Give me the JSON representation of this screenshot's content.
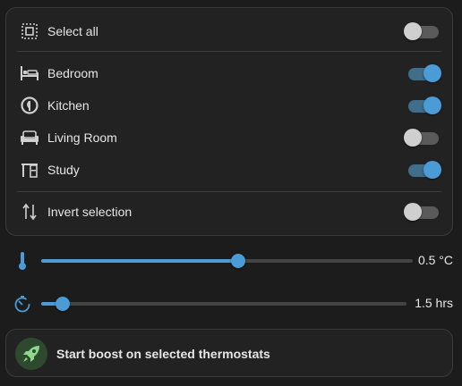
{
  "selection": {
    "select_all": {
      "label": "Select all",
      "on": false
    },
    "rooms": [
      {
        "label": "Bedroom",
        "icon": "bed-icon",
        "on": true
      },
      {
        "label": "Kitchen",
        "icon": "stove-icon",
        "on": true
      },
      {
        "label": "Living Room",
        "icon": "sofa-icon",
        "on": false
      },
      {
        "label": "Study",
        "icon": "desk-icon",
        "on": true
      }
    ],
    "invert": {
      "label": "Invert selection",
      "on": false
    }
  },
  "temperature": {
    "icon": "thermometer-icon",
    "value_text": "0.5 °C",
    "fraction": 0.53
  },
  "duration": {
    "icon": "timer-icon",
    "value_text": "1.5 hrs",
    "fraction": 0.06
  },
  "boost": {
    "label": "Start boost on selected thermostats",
    "icon": "rocket-icon"
  },
  "colors": {
    "accent": "#4a9bd6",
    "track_on": "#3f6d8a",
    "rocket": "#8fd68f"
  }
}
